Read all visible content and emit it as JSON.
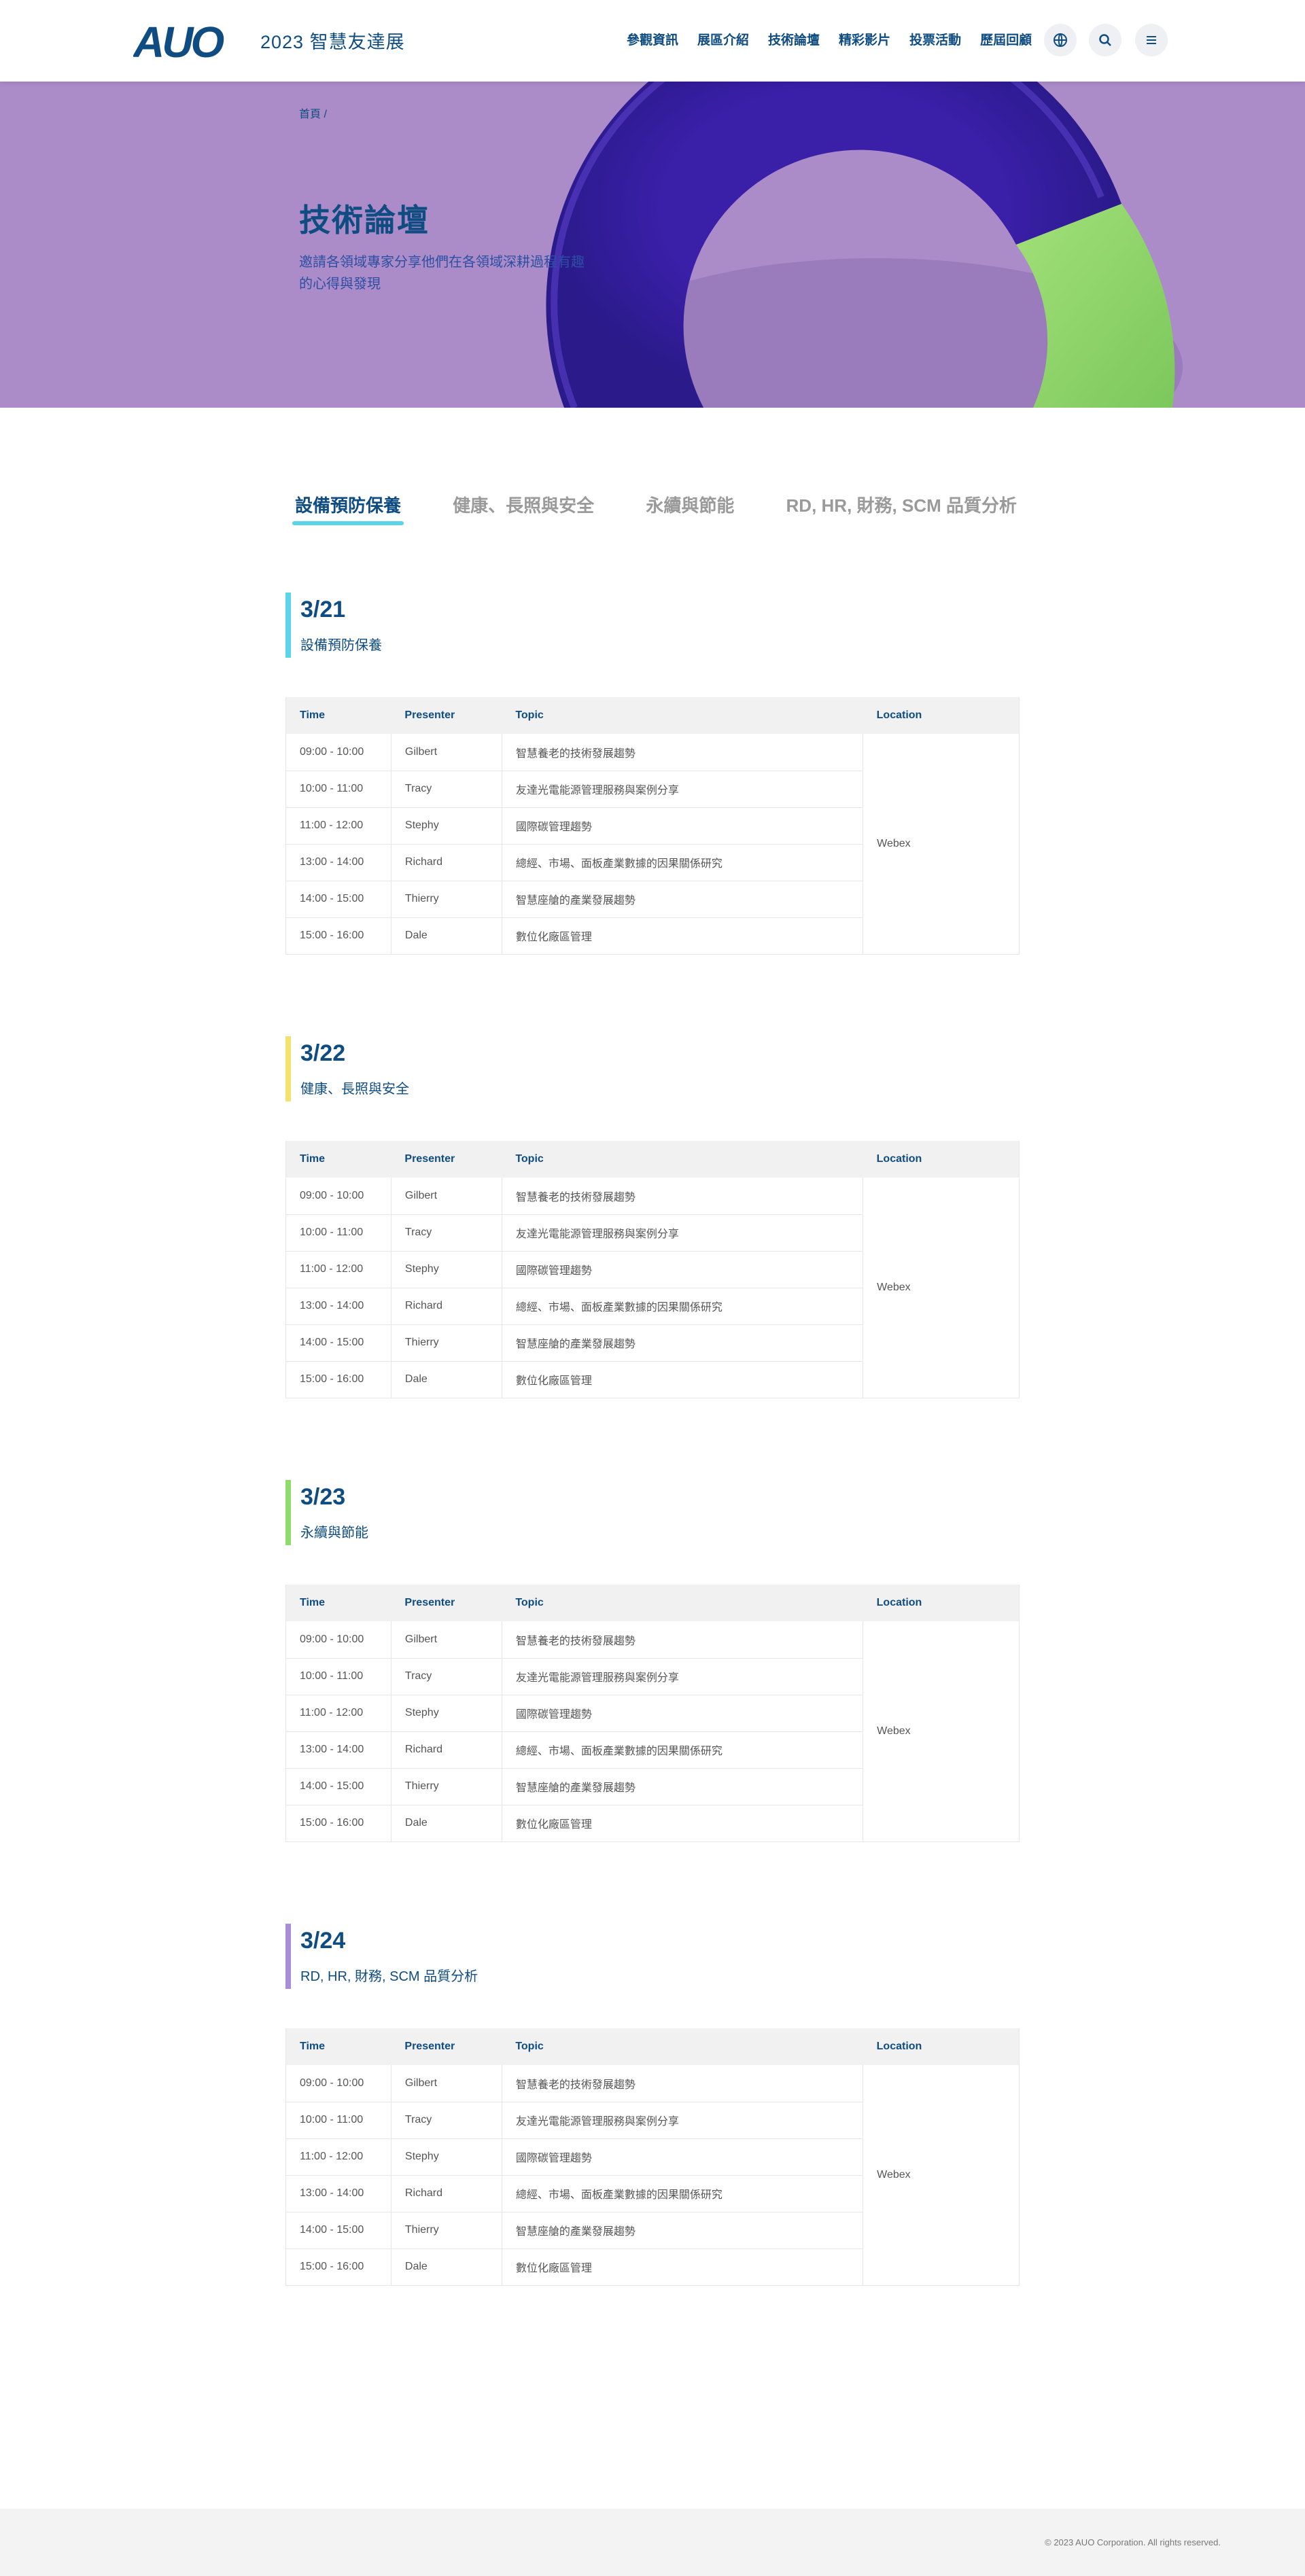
{
  "header": {
    "logo_text": "AUO",
    "site_title": "2023 智慧友達展",
    "nav": [
      "參觀資訊",
      "展區介紹",
      "技術論壇",
      "精彩影片",
      "投票活動",
      "歷屆回顧"
    ]
  },
  "hero": {
    "breadcrumb": "首頁 /",
    "title": "技術論壇",
    "description": "邀請各領域專家分享他們在各領域深耕過程有趣的心得與發現"
  },
  "tabs": [
    "設備預防保養",
    "健康、長照與安全",
    "永續與節能",
    "RD, HR, 財務, SCM 品質分析"
  ],
  "table_headers": {
    "time": "Time",
    "presenter": "Presenter",
    "topic": "Topic",
    "location": "Location"
  },
  "sections": [
    {
      "date": "3/21",
      "subtitle": "設備預防保養",
      "color": "#5bd3e8",
      "location": "Webex",
      "rows": [
        {
          "time": "09:00 - 10:00",
          "presenter": "Gilbert",
          "topic": "智慧養老的技術發展趨勢"
        },
        {
          "time": "10:00 - 11:00",
          "presenter": "Tracy",
          "topic": "友達光電能源管理服務與案例分享"
        },
        {
          "time": "11:00 - 12:00",
          "presenter": "Stephy",
          "topic": "國際碳管理趨勢"
        },
        {
          "time": "13:00 - 14:00",
          "presenter": "Richard",
          "topic": "總經、市場、面板產業數據的因果關係研究"
        },
        {
          "time": "14:00 - 15:00",
          "presenter": "Thierry",
          "topic": "智慧座艙的產業發展趨勢"
        },
        {
          "time": "15:00 - 16:00",
          "presenter": "Dale",
          "topic": "數位化廠區管理"
        }
      ]
    },
    {
      "date": "3/22",
      "subtitle": "健康、長照與安全",
      "color": "#f4e26e",
      "location": "Webex",
      "rows": [
        {
          "time": "09:00 - 10:00",
          "presenter": "Gilbert",
          "topic": "智慧養老的技術發展趨勢"
        },
        {
          "time": "10:00 - 11:00",
          "presenter": "Tracy",
          "topic": "友達光電能源管理服務與案例分享"
        },
        {
          "time": "11:00 - 12:00",
          "presenter": "Stephy",
          "topic": "國際碳管理趨勢"
        },
        {
          "time": "13:00 - 14:00",
          "presenter": "Richard",
          "topic": "總經、市場、面板產業數據的因果關係研究"
        },
        {
          "time": "14:00 - 15:00",
          "presenter": "Thierry",
          "topic": "智慧座艙的產業發展趨勢"
        },
        {
          "time": "15:00 - 16:00",
          "presenter": "Dale",
          "topic": "數位化廠區管理"
        }
      ]
    },
    {
      "date": "3/23",
      "subtitle": "永續與節能",
      "color": "#8edc6e",
      "location": "Webex",
      "rows": [
        {
          "time": "09:00 - 10:00",
          "presenter": "Gilbert",
          "topic": "智慧養老的技術發展趨勢"
        },
        {
          "time": "10:00 - 11:00",
          "presenter": "Tracy",
          "topic": "友達光電能源管理服務與案例分享"
        },
        {
          "time": "11:00 - 12:00",
          "presenter": "Stephy",
          "topic": "國際碳管理趨勢"
        },
        {
          "time": "13:00 - 14:00",
          "presenter": "Richard",
          "topic": "總經、市場、面板產業數據的因果關係研究"
        },
        {
          "time": "14:00 - 15:00",
          "presenter": "Thierry",
          "topic": "智慧座艙的產業發展趨勢"
        },
        {
          "time": "15:00 - 16:00",
          "presenter": "Dale",
          "topic": "數位化廠區管理"
        }
      ]
    },
    {
      "date": "3/24",
      "subtitle": "RD, HR, 財務, SCM 品質分析",
      "color": "#ab8cd8",
      "location": "Webex",
      "rows": [
        {
          "time": "09:00 - 10:00",
          "presenter": "Gilbert",
          "topic": "智慧養老的技術發展趨勢"
        },
        {
          "time": "10:00 - 11:00",
          "presenter": "Tracy",
          "topic": "友達光電能源管理服務與案例分享"
        },
        {
          "time": "11:00 - 12:00",
          "presenter": "Stephy",
          "topic": "國際碳管理趨勢"
        },
        {
          "time": "13:00 - 14:00",
          "presenter": "Richard",
          "topic": "總經、市場、面板產業數據的因果關係研究"
        },
        {
          "time": "14:00 - 15:00",
          "presenter": "Thierry",
          "topic": "智慧座艙的產業發展趨勢"
        },
        {
          "time": "15:00 - 16:00",
          "presenter": "Dale",
          "topic": "數位化廠區管理"
        }
      ]
    }
  ],
  "footer": {
    "copyright": "© 2023 AUO Corporation. All rights reserved."
  }
}
